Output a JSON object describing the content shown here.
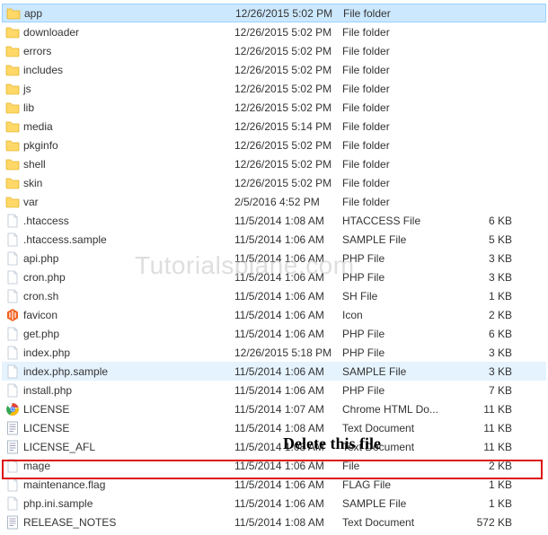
{
  "watermark": "Tutorialsplane.com",
  "annotation": "Delete this file",
  "rows": [
    {
      "name": "app",
      "date": "12/26/2015 5:02 PM",
      "type": "File folder",
      "size": "",
      "icon": "folder",
      "sel": "selected-top"
    },
    {
      "name": "downloader",
      "date": "12/26/2015 5:02 PM",
      "type": "File folder",
      "size": "",
      "icon": "folder",
      "sel": ""
    },
    {
      "name": "errors",
      "date": "12/26/2015 5:02 PM",
      "type": "File folder",
      "size": "",
      "icon": "folder",
      "sel": ""
    },
    {
      "name": "includes",
      "date": "12/26/2015 5:02 PM",
      "type": "File folder",
      "size": "",
      "icon": "folder",
      "sel": ""
    },
    {
      "name": "js",
      "date": "12/26/2015 5:02 PM",
      "type": "File folder",
      "size": "",
      "icon": "folder",
      "sel": ""
    },
    {
      "name": "lib",
      "date": "12/26/2015 5:02 PM",
      "type": "File folder",
      "size": "",
      "icon": "folder",
      "sel": ""
    },
    {
      "name": "media",
      "date": "12/26/2015 5:14 PM",
      "type": "File folder",
      "size": "",
      "icon": "folder",
      "sel": ""
    },
    {
      "name": "pkginfo",
      "date": "12/26/2015 5:02 PM",
      "type": "File folder",
      "size": "",
      "icon": "folder",
      "sel": ""
    },
    {
      "name": "shell",
      "date": "12/26/2015 5:02 PM",
      "type": "File folder",
      "size": "",
      "icon": "folder",
      "sel": ""
    },
    {
      "name": "skin",
      "date": "12/26/2015 5:02 PM",
      "type": "File folder",
      "size": "",
      "icon": "folder",
      "sel": ""
    },
    {
      "name": "var",
      "date": "2/5/2016 4:52 PM",
      "type": "File folder",
      "size": "",
      "icon": "folder",
      "sel": ""
    },
    {
      "name": ".htaccess",
      "date": "11/5/2014 1:08 AM",
      "type": "HTACCESS File",
      "size": "6 KB",
      "icon": "file",
      "sel": ""
    },
    {
      "name": ".htaccess.sample",
      "date": "11/5/2014 1:06 AM",
      "type": "SAMPLE File",
      "size": "5 KB",
      "icon": "file",
      "sel": ""
    },
    {
      "name": "api.php",
      "date": "11/5/2014 1:06 AM",
      "type": "PHP File",
      "size": "3 KB",
      "icon": "file",
      "sel": ""
    },
    {
      "name": "cron.php",
      "date": "11/5/2014 1:06 AM",
      "type": "PHP File",
      "size": "3 KB",
      "icon": "file",
      "sel": ""
    },
    {
      "name": "cron.sh",
      "date": "11/5/2014 1:06 AM",
      "type": "SH File",
      "size": "1 KB",
      "icon": "file",
      "sel": ""
    },
    {
      "name": "favicon",
      "date": "11/5/2014 1:06 AM",
      "type": "Icon",
      "size": "2 KB",
      "icon": "magento",
      "sel": ""
    },
    {
      "name": "get.php",
      "date": "11/5/2014 1:06 AM",
      "type": "PHP File",
      "size": "6 KB",
      "icon": "file",
      "sel": ""
    },
    {
      "name": "index.php",
      "date": "12/26/2015 5:18 PM",
      "type": "PHP File",
      "size": "3 KB",
      "icon": "file",
      "sel": ""
    },
    {
      "name": "index.php.sample",
      "date": "11/5/2014 1:06 AM",
      "type": "SAMPLE File",
      "size": "3 KB",
      "icon": "file",
      "sel": "highlighted"
    },
    {
      "name": "install.php",
      "date": "11/5/2014 1:06 AM",
      "type": "PHP File",
      "size": "7 KB",
      "icon": "file",
      "sel": ""
    },
    {
      "name": "LICENSE",
      "date": "11/5/2014 1:07 AM",
      "type": "Chrome HTML Do...",
      "size": "11 KB",
      "icon": "chrome",
      "sel": ""
    },
    {
      "name": "LICENSE",
      "date": "11/5/2014 1:08 AM",
      "type": "Text Document",
      "size": "11 KB",
      "icon": "text",
      "sel": ""
    },
    {
      "name": "LICENSE_AFL",
      "date": "11/5/2014 1:08 AM",
      "type": "Text Document",
      "size": "11 KB",
      "icon": "text",
      "sel": ""
    },
    {
      "name": "mage",
      "date": "11/5/2014 1:06 AM",
      "type": "File",
      "size": "2 KB",
      "icon": "file",
      "sel": ""
    },
    {
      "name": "maintenance.flag",
      "date": "11/5/2014 1:06 AM",
      "type": "FLAG File",
      "size": "1 KB",
      "icon": "file",
      "sel": ""
    },
    {
      "name": "php.ini.sample",
      "date": "11/5/2014 1:06 AM",
      "type": "SAMPLE File",
      "size": "1 KB",
      "icon": "file",
      "sel": ""
    },
    {
      "name": "RELEASE_NOTES",
      "date": "11/5/2014 1:08 AM",
      "type": "Text Document",
      "size": "572 KB",
      "icon": "text",
      "sel": ""
    }
  ]
}
